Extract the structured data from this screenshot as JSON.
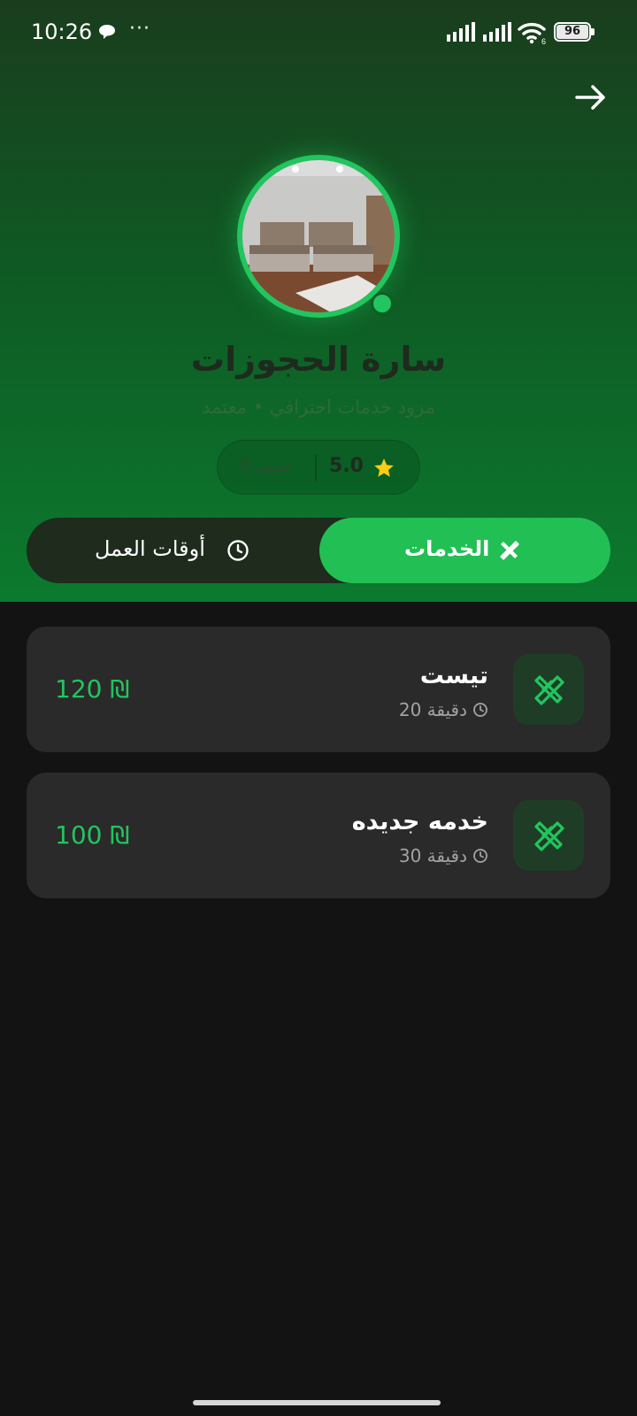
{
  "status_bar": {
    "time": "10:26",
    "dots": "···",
    "battery": "96",
    "wifi_badge": "6"
  },
  "profile": {
    "name": "سارة الحجوزات",
    "subtitle": "مزود خدمات احترافي • معتمد",
    "rating_score": "5.0",
    "rating_count": "0 تقييم",
    "online": true,
    "accent_color": "#22c55e"
  },
  "tabs": {
    "services_label": "الخدمات",
    "hours_label": "أوقات العمل",
    "active": "services"
  },
  "services": [
    {
      "title": "تيست",
      "duration": "20 دقيقة",
      "price": "120 ₪"
    },
    {
      "title": "خدمه جديده",
      "duration": "30 دقيقة",
      "price": "100 ₪"
    }
  ]
}
